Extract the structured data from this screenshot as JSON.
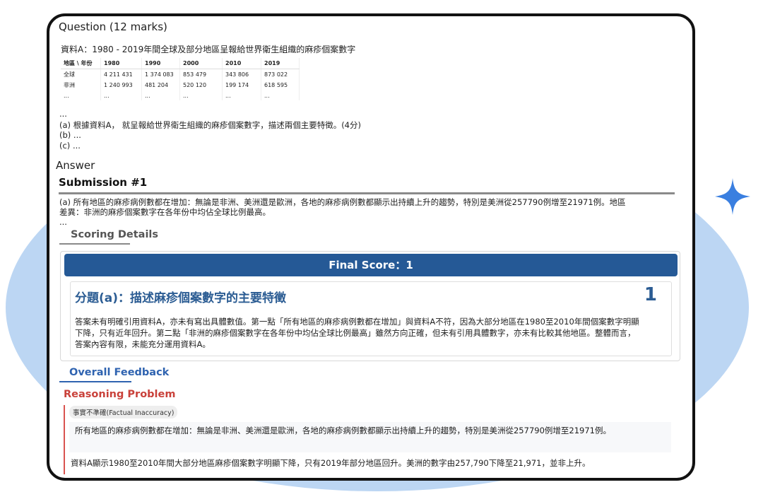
{
  "question": {
    "title": "Question (12 marks)",
    "source_title": "資料A：1980 - 2019年間全球及部分地區呈報給世界衛生組織的麻疹個案數字",
    "table": {
      "headers": [
        "地區 \\ 年份",
        "1980",
        "1990",
        "2000",
        "2010",
        "2019"
      ],
      "rows": [
        [
          "全球",
          "4 211 431",
          "1 374 083",
          "853 479",
          "343 806",
          "873 022"
        ],
        [
          "非洲",
          "1 240 993",
          "481 204",
          "520 120",
          "199 174",
          "618 595"
        ],
        [
          "...",
          "...",
          "...",
          "...",
          "...",
          "..."
        ]
      ]
    },
    "ellipsis": "...",
    "part_a": "(a) 根據資料A， 就呈報給世界衛生組織的麻疹個案數字，描述兩個主要特徵。(4分)",
    "part_b": "(b) ...",
    "part_c": "(c) ..."
  },
  "answer": {
    "label": "Answer",
    "submission_title": "Submission #1",
    "text_line1": "(a) 所有地區的麻疹病例數都在增加：無論是非洲、美洲還是歐洲，各地的麻疹病例數都顯示出持續上升的趨勢，特別是美洲從257790例增至21971例。地區",
    "text_line2": "差異：非洲的麻疹個案數字在各年份中均佔全球比例最高。",
    "text_line3": "..."
  },
  "scoring": {
    "section_title": "Scoring Details",
    "final_score_label": "Final Score：1",
    "sub_question_title": "分題(a)：描述麻疹個案數字的主要特徵",
    "sub_question_score": "1",
    "reasoning": "答案未有明確引用資料A，亦未有寫出具體數值。第一點「所有地區的麻疹病例數都在增加」與資料A不符，因為大部分地區在1980至2010年間個案數字明顯下降，只有近年回升。第二點「非洲的麻疹個案數字在各年份中均佔全球比例最高」雖然方向正確，但未有引用具體數字，亦未有比較其他地區。整體而言，答案內容有限，未能充分運用資料A。"
  },
  "feedback": {
    "section_title": "Overall Feedback",
    "problem_title": "Reasoning Problem",
    "tag": "事實不準確(Factual Inaccuracy)",
    "quote": "所有地區的麻疹病例數都在增加：無論是非洲、美洲還是歐洲，各地的麻疹病例數都顯示出持續上升的趨勢，特別是美洲從257790例增至21971例。",
    "explanation": "資料A顯示1980至2010年間大部分地區麻疹個案數字明顯下降，只有2019年部分地區回升。美洲的數字由257,790下降至21,971，並非上升。"
  },
  "colors": {
    "accent_blue": "#255996",
    "title_blue": "#2b5c93",
    "feedback_blue": "#2f63b0",
    "problem_red": "#c9413a",
    "background_circle": "#bcd6f3",
    "sparkle": "#3a7fe0"
  },
  "icons": [
    "sparkle-icon"
  ]
}
